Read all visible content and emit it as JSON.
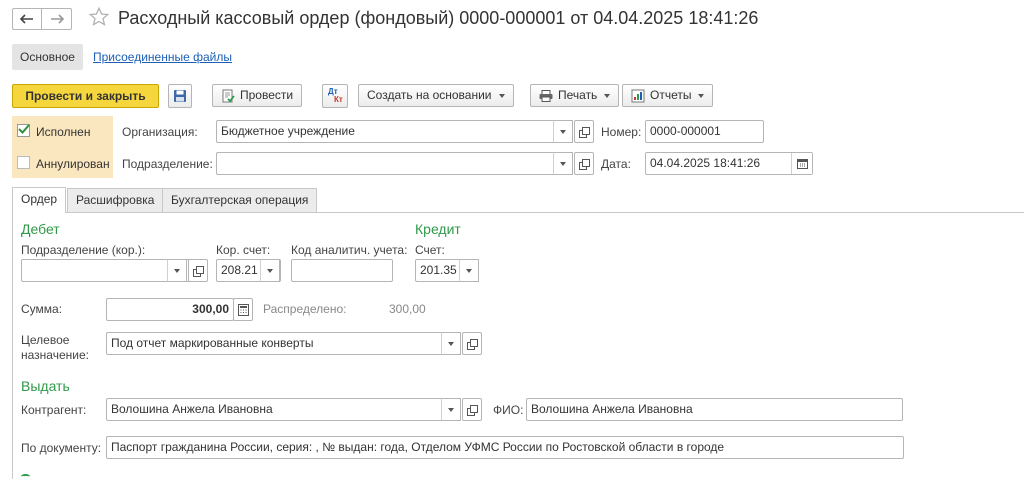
{
  "title": "Расходный кассовый ордер (фондовый) 0000-000001 от 04.04.2025 18:41:26",
  "nav_tabs": [
    "Основное",
    "Присоединенные файлы"
  ],
  "toolbar": {
    "post_close": "Провести и закрыть",
    "post": "Провести",
    "create_based": "Создать на основании",
    "print": "Печать",
    "reports": "Отчеты"
  },
  "status": {
    "executed": "Исполнен",
    "executed_checked": true,
    "cancelled": "Аннулирован",
    "cancelled_checked": false
  },
  "header": {
    "org_label": "Организация:",
    "org_value": "Бюджетное учреждение",
    "dept_label": "Подразделение:",
    "dept_value": "",
    "number_label": "Номер:",
    "number_value": "0000-000001",
    "date_label": "Дата:",
    "date_value": "04.04.2025 18:41:26"
  },
  "doc_tabs": [
    "Ордер",
    "Расшифровка",
    "Бухгалтерская операция"
  ],
  "debit": {
    "title": "Дебет",
    "dept_label": "Подразделение (кор.):",
    "dept_value": "",
    "account_label": "Кор. счет:",
    "account_value": "208.21",
    "analytic_label": "Код аналитич. учета:",
    "analytic_value": ""
  },
  "credit": {
    "title": "Кредит",
    "account_label": "Счет:",
    "account_value": "201.35"
  },
  "sum": {
    "label": "Сумма:",
    "value": "300,00",
    "distributed_label": "Распределено:",
    "distributed_value": "300,00"
  },
  "purpose": {
    "label_line1": "Целевое",
    "label_line2": "назначение:",
    "value": "Под отчет маркированные конверты"
  },
  "issue": {
    "title": "Выдать",
    "counterparty_label": "Контрагент:",
    "counterparty_value": "Волошина Анжела Ивановна",
    "fio_label": "ФИО:",
    "fio_value": "Волошина Анжела Ивановна",
    "doc_label": "По документу:",
    "doc_value": "Паспорт гражданина России, серия: , №  выдан:  года, Отделом УФМС России по Ростовской области в городе"
  },
  "colors": {
    "accent_yellow": "#f5d73d",
    "section_green": "#2f9a4a",
    "link_blue": "#1c5fb5",
    "status_panel": "#fbe7bf"
  }
}
